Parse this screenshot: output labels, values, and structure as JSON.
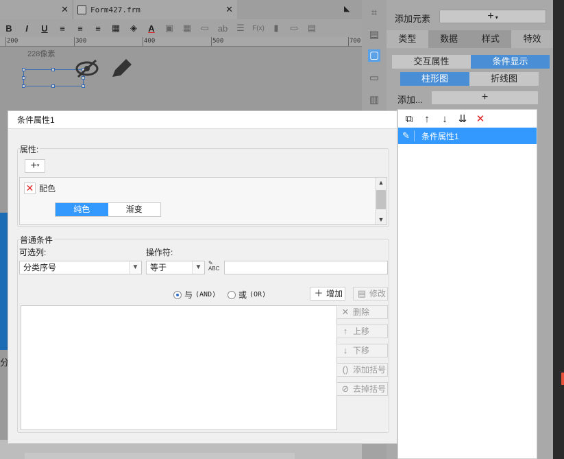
{
  "tabs": [
    {
      "label": ""
    },
    {
      "label": "Form427.frm"
    }
  ],
  "ruler": {
    "ticks": [
      "200",
      "300",
      "400",
      "500",
      "700"
    ]
  },
  "canvas": {
    "note": "228像素"
  },
  "toolbar": {
    "bold": "B",
    "italic": "I",
    "underline": "U",
    "text_tool": "ab",
    "formula": "F(x)"
  },
  "side_label": "分",
  "right_panel": {
    "add_element_label": "添加元素",
    "add_element_value": "+",
    "tabs": [
      "类型",
      "数据",
      "样式",
      "特效"
    ],
    "sub_tabs": [
      "交互属性",
      "条件显示"
    ],
    "chart_tabs": [
      "柱形图",
      "折线图"
    ],
    "add_label": "添加...",
    "add_button": "+",
    "list_items": [
      "条件属性1"
    ]
  },
  "dialog": {
    "title": "条件属性1",
    "attr_group_label": "属性:",
    "attr_add": "+",
    "attr_row_label": "配色",
    "attr_seg": [
      "纯色",
      "渐变"
    ],
    "cond_group_label": "普通条件",
    "column_label": "可选列:",
    "operator_label": "操作符:",
    "column_value": "分类序号",
    "operator_value": "等于",
    "value_input": "",
    "radio_and_label": "与",
    "radio_and_sub": "(AND)",
    "radio_or_label": "或",
    "radio_or_sub": "(OR)",
    "buttons": {
      "add": "增加",
      "modify": "修改",
      "delete": "删除",
      "move_up": "上移",
      "move_down": "下移",
      "add_bracket": "添加括号",
      "remove_bracket": "去掉括号"
    }
  }
}
